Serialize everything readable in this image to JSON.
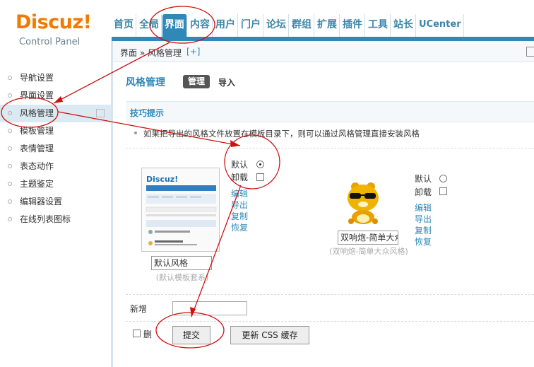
{
  "header": {
    "logo_brand": "Discuz!",
    "logo_sub": "Control Panel",
    "nav": [
      "首页",
      "全局",
      "界面",
      "内容",
      "用户",
      "门户",
      "论坛",
      "群组",
      "扩展",
      "插件",
      "工具",
      "站长",
      "UCenter"
    ],
    "active_nav": "界面"
  },
  "breadcrumb": {
    "text": "界面 » 风格管理",
    "add": "[+]"
  },
  "sidebar": {
    "items": [
      {
        "label": "导航设置"
      },
      {
        "label": "界面设置"
      },
      {
        "label": "风格管理",
        "active": true
      },
      {
        "label": "模板管理"
      },
      {
        "label": "表情管理"
      },
      {
        "label": "表态动作"
      },
      {
        "label": "主题鉴定"
      },
      {
        "label": "编辑器设置"
      },
      {
        "label": "在线列表图标"
      }
    ]
  },
  "main": {
    "title": "风格管理",
    "tab_manage": "管理",
    "tab_import": "导入",
    "tips_title": "技巧提示",
    "tip_text": "如果把导出的风格文件放置在模板目录下，则可以通过风格管理直接安装风格",
    "styles": [
      {
        "radio_default": "默认",
        "radio_uninstall": "卸载",
        "links": [
          "编辑",
          "导出",
          "复制",
          "恢复"
        ],
        "name_value": "默认风格",
        "dir_label": "(默认模板套系)",
        "thumb_brand": "Discuz!"
      },
      {
        "radio_default": "默认",
        "radio_uninstall": "卸载",
        "links": [
          "编辑",
          "导出",
          "复制",
          "恢复"
        ],
        "name_value": "双响炮-简单大众",
        "dir_label": "(双响炮-简单大众风格)"
      }
    ],
    "new_label": "新增",
    "delete_label": "删",
    "submit_label": "提交",
    "css_label": "更新 CSS 缓存"
  },
  "colors": {
    "brand": "#f17b00",
    "accent": "#2f89b8",
    "annotation": "#d01010"
  }
}
